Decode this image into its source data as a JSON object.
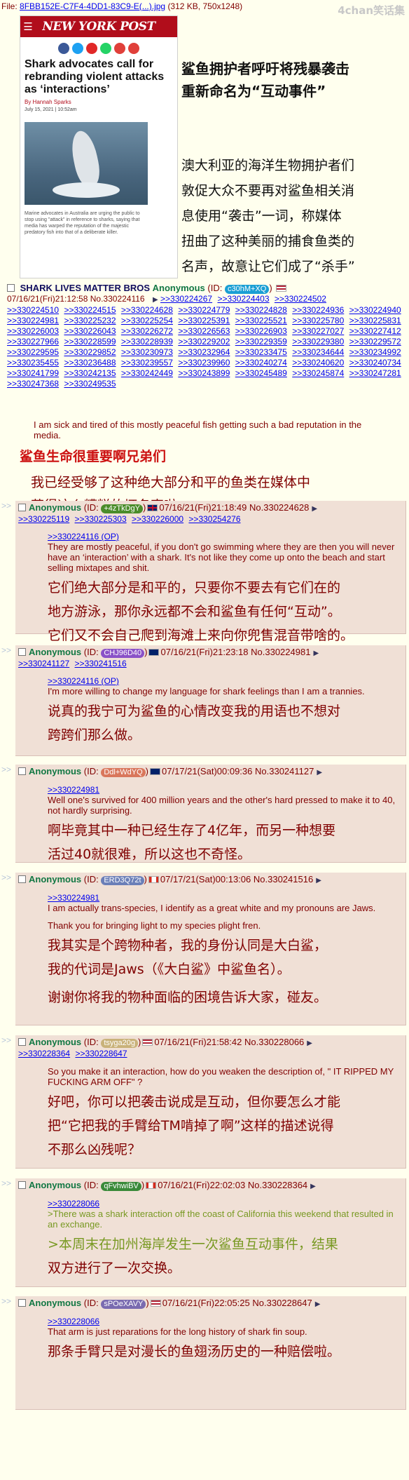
{
  "file": {
    "label": "File:",
    "link": "8FBB152E-C7F4-4DD1-83C9-E(...).jpg",
    "meta": "(312 KB, 750x1248)"
  },
  "watermark": "4chan笑话集",
  "newspaper": {
    "logo": "NEW YORK POST",
    "headline": "Shark advocates call for rebranding violent attacks as ‘interactions’",
    "byline": "By Hannah Sparks",
    "date": "July 15, 2021 | 10:52am",
    "caption": "Marine advocates in Australia are urging the public to stop using \"attack\" in reference to sharks, saying that media has warped the reputation of the majestic predatory fish into that of a deliberate killer."
  },
  "translation": {
    "title_lines": [
      "鲨鱼拥护者呼吁将残暴袭击",
      "重新命名为“互动事件”"
    ],
    "body_lines": [
      "澳大利亚的海洋生物拥护者们",
      "敦促大众不要再对鲨鱼相关消",
      "息使用“袭击”一词，称媒体",
      "扭曲了这种美丽的捕食鱼类的",
      "名声，故意让它们成了“杀手”"
    ]
  },
  "op": {
    "subject": "SHARK LIVES MATTER BROS",
    "name": "Anonymous",
    "id_label": "(ID:",
    "id": "c30hM+XQ",
    "id_close": ")",
    "datetime": "07/16/21(Fri)21:12:58",
    "number": "No.330224116",
    "replies_row1": [
      ">>330224267",
      ">>330224403",
      ">>330224502"
    ],
    "replies": [
      ">>330224510",
      ">>330224515",
      ">>330224628",
      ">>330224779",
      ">>330224828",
      ">>330224936",
      ">>330224940",
      ">>330224981",
      ">>330225232",
      ">>330225254",
      ">>330225391",
      ">>330225521",
      ">>330225780",
      ">>330225831",
      ">>330226003",
      ">>330226043",
      ">>330226272",
      ">>330226563",
      ">>330226903",
      ">>330227027",
      ">>330227412",
      ">>330227966",
      ">>330228599",
      ">>330228939",
      ">>330229202",
      ">>330229359",
      ">>330229380",
      ">>330229572",
      ">>330229595",
      ">>330229852",
      ">>330230973",
      ">>330232964",
      ">>330233475",
      ">>330234644",
      ">>330234992",
      ">>330235455",
      ">>330236488",
      ">>330239557",
      ">>330239960",
      ">>330240274",
      ">>330240620",
      ">>330240734",
      ">>330241799",
      ">>330242135",
      ">>330242449",
      ">>330243899",
      ">>330245489",
      ">>330245874",
      ">>330247281",
      ">>330247368",
      ">>330249535"
    ],
    "comment": "I am sick and tired of this mostly peaceful fish getting such a bad reputation in the media.",
    "trans_subject": "鲨鱼生命很重要啊兄弟们",
    "trans_lines": [
      "我已经受够了这种绝大部分和平的鱼类在媒体中",
      "获得这么糟糕的坏名声啦。"
    ]
  },
  "posts": [
    {
      "name": "Anonymous",
      "id": "+4zTkDgY",
      "id_color": "#4a8c2a",
      "flag": "gb",
      "datetime": "07/16/21(Fri)21:18:49",
      "number": "No.330224628",
      "replies": [
        ">>330225119",
        ">>330225303",
        ">>330226000",
        ">>330254276"
      ],
      "quote": ">>330224116 (OP)",
      "lines": [
        "They are mostly peaceful, if you don't go swimming where they are then you will never have an ‘interaction’ with a shark. It's not like they come up onto the beach and start selling mixtapes and shit."
      ],
      "trans": [
        "它们绝大部分是和平的，只要你不要去有它们在的",
        "地方游泳，那你永远都不会和鲨鱼有任何“互动”。",
        "它们又不会自己爬到海滩上来向你兜售混音带啥的。"
      ]
    },
    {
      "name": "Anonymous",
      "id": "CHJ96D40",
      "id_color": "#8a52c8",
      "flag": "au",
      "datetime": "07/16/21(Fri)21:23:18",
      "number": "No.330224981",
      "replies": [
        ">>330241127",
        ">>330241516"
      ],
      "quote": ">>330224116 (OP)",
      "lines": [
        "I'm more willing to change my language for shark feelings than I am a trannies."
      ],
      "trans": [
        "说真的我宁可为鲨鱼的心情改变我的用语也不想对",
        "跨跨们那么做。"
      ]
    },
    {
      "name": "Anonymous",
      "id": "Ddl+WdYQ",
      "id_color": "#d9775c",
      "flag": "au",
      "datetime": "07/17/21(Sat)00:09:36",
      "number": "No.330241127",
      "replies": [],
      "quote": ">>330224981",
      "lines": [
        "Well one's survived for 400 million years and the other's hard pressed to make it to 40, not hardly surprising."
      ],
      "trans": [
        "啊毕竟其中一种已经生存了4亿年，而另一种想要",
        "活过40就很难，所以这也不奇怪。"
      ]
    },
    {
      "name": "Anonymous",
      "id": "ERD3Q72t",
      "id_color": "#6b7fb8",
      "flag": "ca",
      "datetime": "07/17/21(Sat)00:13:06",
      "number": "No.330241516",
      "replies": [],
      "quote": ">>330224981",
      "lines": [
        "I am actually trans-species, I identify as a great white and my pronouns are Jaws.",
        "Thank you for bringing light to my species plight fren."
      ],
      "trans": [
        "我其实是个跨物种者，我的身份认同是大白鲨，",
        "我的代词是Jaws（《大白鲨》中鲨鱼名）。",
        "谢谢你将我的物种面临的困境告诉大家，碰友。"
      ]
    },
    {
      "name": "Anonymous",
      "id": "tsyga20g",
      "id_color": "#c9b27a",
      "flag": "us",
      "datetime": "07/16/21(Fri)21:58:42",
      "number": "No.330228066",
      "replies": [
        ">>330228364",
        ">>330228647"
      ],
      "quote": "",
      "lines": [
        "So you make it an interaction, how do you weaken the description of, \" IT RIPPED MY FUCKING ARM OFF\" ?"
      ],
      "trans": [
        "好吧，你可以把袭击说成是互动，但你要怎么才能",
        "把“它把我的手臂给TM啃掉了啊”这样的描述说得",
        "不那么凶残呢？"
      ]
    },
    {
      "name": "Anonymous",
      "id": "qFvhwiBV",
      "id_color": "#3a8a3a",
      "flag": "ca",
      "datetime": "07/16/21(Fri)22:02:03",
      "number": "No.330228364",
      "replies": [],
      "quote": ">>330228066",
      "lines": [
        ">There was a shark interaction off the coast of California this weekend that resulted in an exchange."
      ],
      "trans": [
        ">本周末在加州海岸发生一次鲨鱼互动事件，结果",
        "双方进行了一次交换。"
      ]
    },
    {
      "name": "Anonymous",
      "id": "sPOeXAVY",
      "id_color": "#7a6bb0",
      "flag": "us",
      "datetime": "07/16/21(Fri)22:05:25",
      "number": "No.330228647",
      "replies": [],
      "quote": ">>330228066",
      "lines": [
        "That arm is just reparations for the long history of shark fin soup."
      ],
      "trans": [
        "那条手臂只是对漫长的鱼翅汤历史的一种赔偿啦。"
      ]
    }
  ]
}
